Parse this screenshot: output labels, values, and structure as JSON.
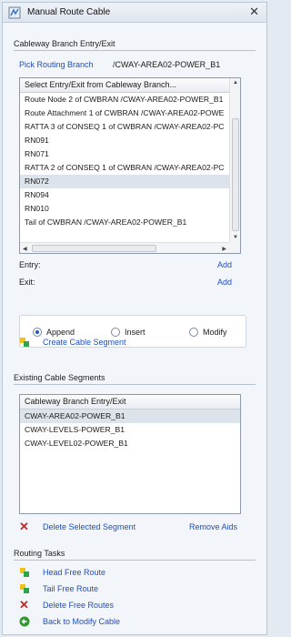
{
  "window": {
    "title": "Manual Route Cable"
  },
  "branch_section": {
    "heading": "Cableway Branch Entry/Exit",
    "pick_label": "Pick Routing Branch",
    "branch_value": "/CWAY-AREA02-POWER_B1",
    "list_header": "Select Entry/Exit from Cableway Branch...",
    "items": [
      "Route Node 2 of CWBRAN /CWAY-AREA02-POWER_B1",
      "Route Attachment 1 of CWBRAN /CWAY-AREA02-POWE",
      "RATTA 3 of CONSEQ 1 of CWBRAN /CWAY-AREA02-PC",
      "RN091",
      "RN071",
      "RATTA 2 of CONSEQ 1 of CWBRAN /CWAY-AREA02-PC",
      "RN072",
      "RN094",
      "RN010",
      "Tail of CWBRAN /CWAY-AREA02-POWER_B1"
    ],
    "entry_label": "Entry:",
    "exit_label": "Exit:",
    "add_label": "Add",
    "add_label_2": "Add"
  },
  "mode": {
    "options": [
      "Append",
      "Insert",
      "Modify"
    ],
    "selected": "Append"
  },
  "create_segment": "Create Cable Segment",
  "existing_section": {
    "heading": "Existing Cable Segments",
    "list_header": "Cableway Branch Entry/Exit",
    "items": [
      "CWAY-AREA02-POWER_B1",
      "CWAY-LEVELS-POWER_B1",
      "CWAY-LEVEL02-POWER_B1"
    ],
    "delete_label": "Delete Selected Segment",
    "remove_aids_label": "Remove Aids"
  },
  "routing_tasks": {
    "heading": "Routing Tasks",
    "head_free_route": "Head Free Route",
    "tail_free_route": "Tail Free Route",
    "delete_free_routes": "Delete Free Routes",
    "back_to_modify": "Back to Modify Cable"
  },
  "colors": {
    "link": "#1f4fbf",
    "delete_red": "#d62020",
    "back_green": "#2f9a2f"
  }
}
